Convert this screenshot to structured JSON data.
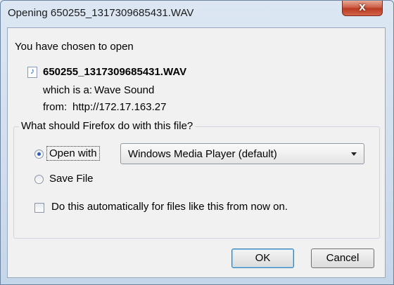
{
  "window": {
    "title": "Opening 650255_1317309685431.WAV",
    "close_label": "x"
  },
  "intro": "You have chosen to open",
  "file": {
    "name": "650255_1317309685431.WAV",
    "type_label": "which is a:",
    "type_value": "Wave Sound",
    "from_label": "from:",
    "from_value": "http://172.17.163.27"
  },
  "action_group": {
    "label": "What should Firefox do with this file?",
    "open_with": {
      "label": "Open with",
      "selected": true
    },
    "app_select": {
      "value": "Windows Media Player (default)"
    },
    "save_file": {
      "label": "Save File",
      "selected": false
    },
    "auto_checkbox": {
      "label": "Do this automatically for files like this from now on.",
      "checked": false
    }
  },
  "buttons": {
    "ok": "OK",
    "cancel": "Cancel"
  },
  "colors": {
    "title_bar": "#dce7f3",
    "close_button": "#c8553e",
    "dialog_bg": "#f1f1f1"
  }
}
